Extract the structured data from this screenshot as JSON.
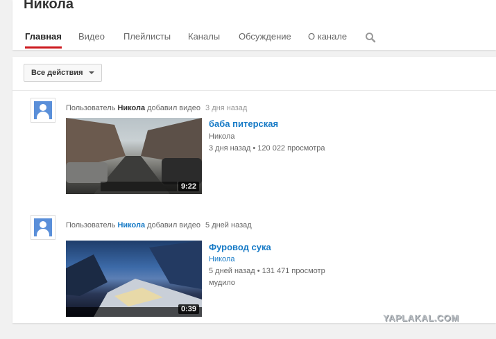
{
  "channel": {
    "name": "Никола"
  },
  "tabs": [
    {
      "label": "Главная",
      "active": true
    },
    {
      "label": "Видео"
    },
    {
      "label": "Плейлисты"
    },
    {
      "label": "Каналы"
    },
    {
      "label": "Обсуждение"
    },
    {
      "label": "О канале"
    }
  ],
  "search_icon": "search-icon",
  "filter": {
    "label": "Все действия"
  },
  "activities": [
    {
      "prefix": "Пользователь",
      "author": "Никола",
      "action": "добавил видео",
      "time": "3 дня назад",
      "video": {
        "title": "баба питерская",
        "channel": "Никола",
        "views": "3 дня назад • 120 022 просмотра",
        "description": "",
        "duration": "9:22"
      }
    },
    {
      "prefix": "Пользователь",
      "author": "Никола",
      "action": "добавил видео",
      "time": "5 дней назад",
      "video": {
        "title": "Фуровод сука",
        "channel": "Никола",
        "views": "5 дней назад • 131 471 просмотр",
        "description": "мудило",
        "duration": "0:39"
      }
    }
  ],
  "watermark": "YAPLAKAL.COM",
  "colors": {
    "accent": "#cc181e",
    "link": "#167ac6"
  }
}
